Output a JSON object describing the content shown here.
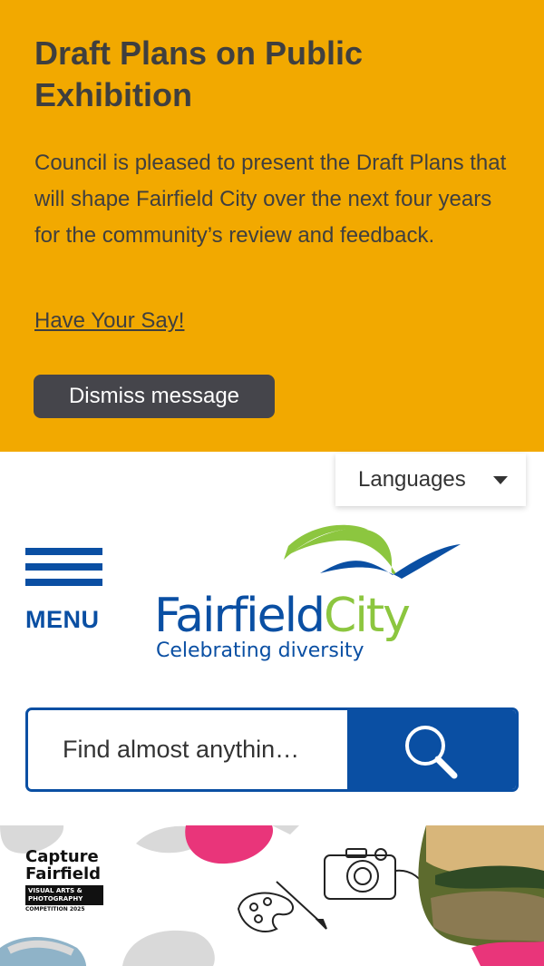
{
  "notice": {
    "title": "Draft Plans on Public Exhibition",
    "body": "Council is pleased to present the Draft Plans that will shape Fairfield City over the next four years for the community’s review and feedback.",
    "link": "Have Your Say!",
    "dismiss": "Dismiss message",
    "background": "#f2a900"
  },
  "languages": {
    "label": "Languages"
  },
  "menu": {
    "label": "MENU"
  },
  "logo": {
    "name": "FairfieldCity",
    "name_part1": "Fairfield",
    "name_part2": "City",
    "tagline": "Celebrating diversity"
  },
  "search": {
    "placeholder": "Find almost anythin…",
    "icon": "search-icon"
  },
  "banner": {
    "line1": "Capture",
    "line2": "Fairfield",
    "line3": "VISUAL ARTS &",
    "line4": "PHOTOGRAPHY",
    "line5": "COMPETITION 2025"
  },
  "colors": {
    "brand_blue": "#0a4fa3",
    "brand_green": "#8cc63f",
    "accent_pink": "#e9357a"
  }
}
